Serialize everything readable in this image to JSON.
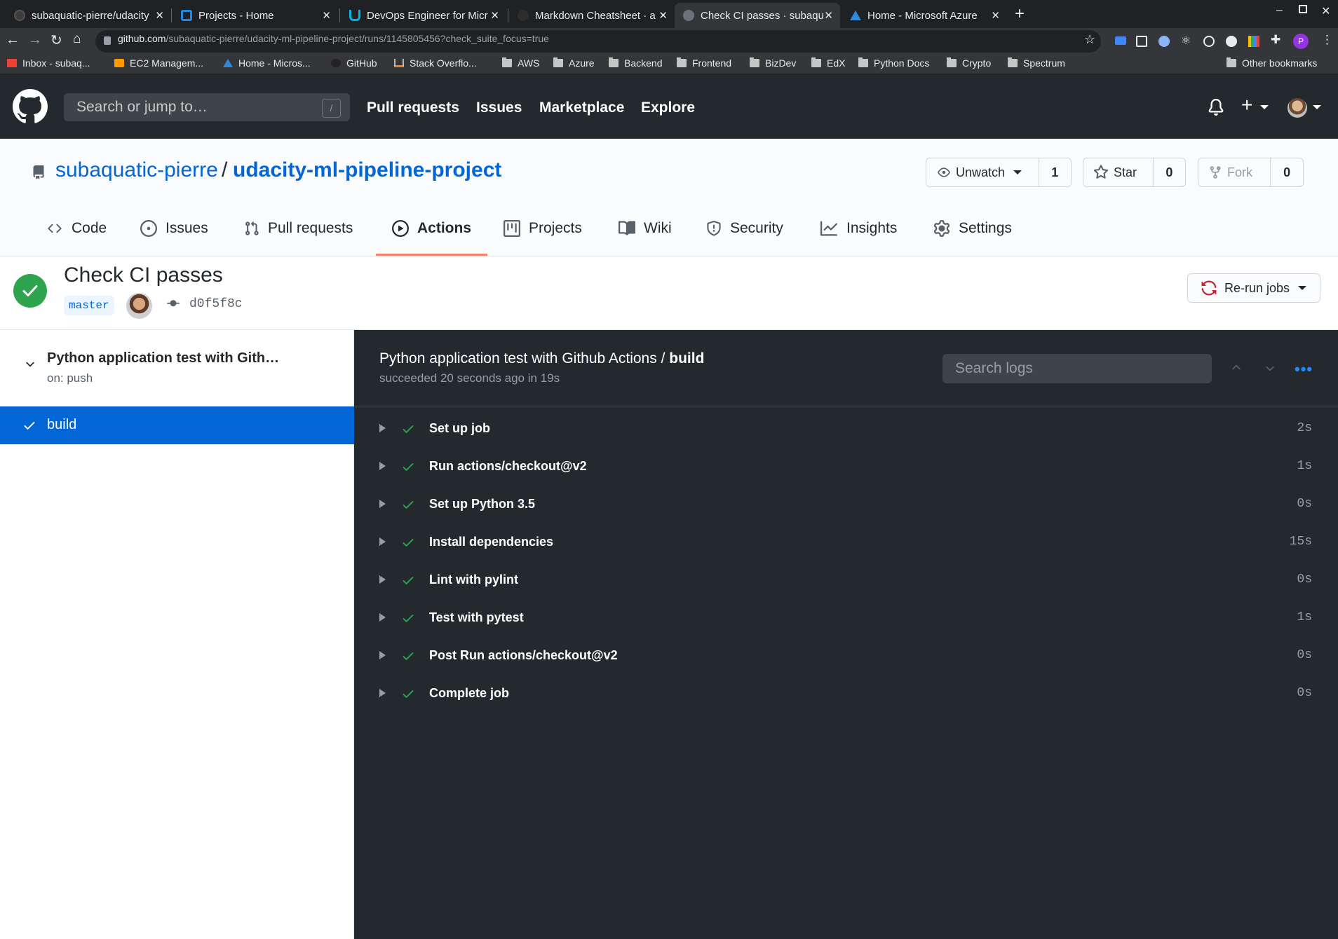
{
  "browser": {
    "tabs": [
      {
        "label": "subaquatic-pierre/udacity",
        "active": false
      },
      {
        "label": "Projects - Home",
        "active": false
      },
      {
        "label": "DevOps Engineer for Micr",
        "active": false
      },
      {
        "label": "Markdown Cheatsheet · a",
        "active": false
      },
      {
        "label": "Check CI passes · subaqua",
        "active": true
      },
      {
        "label": "Home - Microsoft Azure",
        "active": false
      }
    ],
    "url_host": "github.com",
    "url_path": "/subaquatic-pierre/udacity-ml-pipeline-project/runs/1145805456?check_suite_focus=true",
    "bookmarks": [
      {
        "label": "Inbox - subaq...",
        "icon": "gmail-icon"
      },
      {
        "label": "EC2 Managem...",
        "icon": "aws-icon"
      },
      {
        "label": "Home - Micros...",
        "icon": "azure-icon"
      },
      {
        "label": "GitHub",
        "icon": "github-icon"
      },
      {
        "label": "Stack Overflo...",
        "icon": "stackoverflow-icon"
      },
      {
        "label": "AWS",
        "icon": "folder-icon"
      },
      {
        "label": "Azure",
        "icon": "folder-icon"
      },
      {
        "label": "Backend",
        "icon": "folder-icon"
      },
      {
        "label": "Frontend",
        "icon": "folder-icon"
      },
      {
        "label": "BizDev",
        "icon": "folder-icon"
      },
      {
        "label": "EdX",
        "icon": "folder-icon"
      },
      {
        "label": "Python Docs",
        "icon": "folder-icon"
      },
      {
        "label": "Crypto",
        "icon": "folder-icon"
      },
      {
        "label": "Spectrum",
        "icon": "folder-icon"
      }
    ],
    "other_bookmarks": "Other bookmarks",
    "profile_initial": "P"
  },
  "github": {
    "search_placeholder": "Search or jump to…",
    "search_key": "/",
    "nav": [
      "Pull requests",
      "Issues",
      "Marketplace",
      "Explore"
    ]
  },
  "repo": {
    "owner": "subaquatic-pierre",
    "separator": "/",
    "name": "udacity-ml-pipeline-project",
    "watch_label": "Unwatch",
    "watch_count": "1",
    "star_label": "Star",
    "star_count": "0",
    "fork_label": "Fork",
    "fork_count": "0",
    "tabs": [
      "Code",
      "Issues",
      "Pull requests",
      "Actions",
      "Projects",
      "Wiki",
      "Security",
      "Insights",
      "Settings"
    ],
    "active_tab": "Actions"
  },
  "run": {
    "title": "Check CI passes",
    "branch": "master",
    "commit": "d0f5f8c",
    "rerun_label": "Re-run jobs",
    "workflow_name": "Python application test with Gith…",
    "trigger": "on: push",
    "job": "build"
  },
  "log": {
    "workflow": "Python application test with Github Actions",
    "separator": "/",
    "job": "build",
    "status": "succeeded 20 seconds ago in 19s",
    "search_placeholder": "Search logs",
    "steps": [
      {
        "name": "Set up job",
        "duration": "2s"
      },
      {
        "name": "Run actions/checkout@v2",
        "duration": "1s"
      },
      {
        "name": "Set up Python 3.5",
        "duration": "0s"
      },
      {
        "name": "Install dependencies",
        "duration": "15s"
      },
      {
        "name": "Lint with pylint",
        "duration": "0s"
      },
      {
        "name": "Test with pytest",
        "duration": "1s"
      },
      {
        "name": "Post Run actions/checkout@v2",
        "duration": "0s"
      },
      {
        "name": "Complete job",
        "duration": "0s"
      }
    ]
  },
  "colors": {
    "success": "#2ea44f",
    "link": "#0366d6",
    "active_tab_underline": "#f9826c",
    "log_bg": "#24292e"
  }
}
